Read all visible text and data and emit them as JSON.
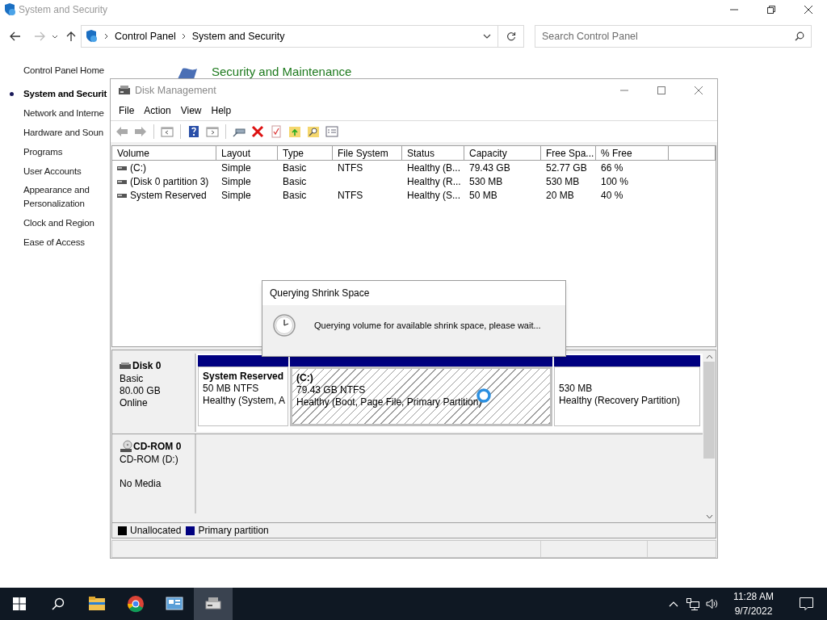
{
  "control_panel": {
    "title": "System and Security",
    "breadcrumb": [
      "Control Panel",
      "System and Security"
    ],
    "search": {
      "placeholder": "Search Control Panel"
    },
    "nav": [
      {
        "label": "Control Panel Home",
        "selected": false
      },
      {
        "label": "System and Securit",
        "selected": true
      },
      {
        "label": "Network and Interne",
        "selected": false
      },
      {
        "label": "Hardware and Soun",
        "selected": false
      },
      {
        "label": "Programs",
        "selected": false
      },
      {
        "label": "User Accounts",
        "selected": false
      },
      {
        "label": "Appearance and Personalization",
        "selected": false
      },
      {
        "label": "Clock and Region",
        "selected": false
      },
      {
        "label": "Ease of Access",
        "selected": false
      }
    ],
    "heading": "Security and Maintenance"
  },
  "disk_management": {
    "title": "Disk Management",
    "menu": [
      "File",
      "Action",
      "View",
      "Help"
    ],
    "volumes": {
      "columns": [
        "Volume",
        "Layout",
        "Type",
        "File System",
        "Status",
        "Capacity",
        "Free Spa...",
        "% Free"
      ],
      "rows": [
        [
          "(C:)",
          "Simple",
          "Basic",
          "NTFS",
          "Healthy (B...",
          "79.43 GB",
          "52.77 GB",
          "66 %"
        ],
        [
          "(Disk 0 partition 3)",
          "Simple",
          "Basic",
          "",
          "Healthy (R...",
          "530 MB",
          "530 MB",
          "100 %"
        ],
        [
          "System Reserved",
          "Simple",
          "Basic",
          "NTFS",
          "Healthy (S...",
          "50 MB",
          "20 MB",
          "40 %"
        ]
      ]
    },
    "disks": [
      {
        "kind": "disk",
        "name": "Disk 0",
        "lines": [
          "Basic",
          "80.00 GB",
          "Online"
        ],
        "partitions": [
          {
            "title": "System Reserved",
            "size": "50 MB NTFS",
            "status": "Healthy (System, A",
            "selected": false
          },
          {
            "title": "(C:)",
            "size": "79.43 GB NTFS",
            "status": "Healthy (Boot, Page File, Primary Partition)",
            "selected": true
          },
          {
            "size": "530 MB",
            "status": "Healthy (Recovery Partition)",
            "selected": false
          }
        ]
      },
      {
        "kind": "cdrom",
        "name": "CD-ROM 0",
        "lines": [
          "CD-ROM (D:)",
          "No Media"
        ]
      }
    ],
    "legend": [
      {
        "label": "Unallocated",
        "color": "#000000"
      },
      {
        "label": "Primary partition",
        "color": "#000080"
      }
    ]
  },
  "dialog": {
    "title": "Querying Shrink Space",
    "message": "Querying volume for available shrink space, please wait..."
  },
  "taskbar": {
    "apps": [
      {
        "kind": "explorer",
        "active": false
      },
      {
        "kind": "browser",
        "active": false
      },
      {
        "kind": "control-panel",
        "active": false
      },
      {
        "kind": "disk-management",
        "active": true
      }
    ],
    "time": "11:28 AM",
    "date": "9/7/2022"
  }
}
